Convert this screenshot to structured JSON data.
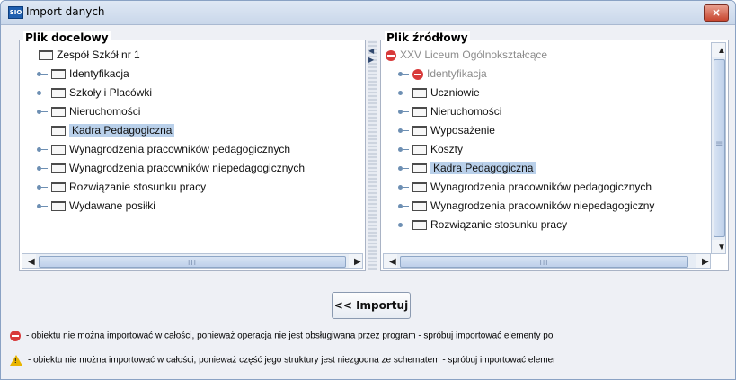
{
  "window": {
    "app_icon_text": "SIO",
    "title": "Import danych",
    "close_label": "×"
  },
  "left_panel": {
    "legend": "Plik docelowy",
    "items": [
      {
        "label": "Zespół Szkół nr 1",
        "icon": "folder-icon",
        "level": 0
      },
      {
        "label": "Identyfikacja",
        "icon": "folder-icon",
        "level": 1
      },
      {
        "label": "Szkoły i Placówki",
        "icon": "folder-icon",
        "level": 1
      },
      {
        "label": "Nieruchomości",
        "icon": "folder-icon",
        "level": 1
      },
      {
        "label": "Kadra Pedagogiczna",
        "icon": "folder-icon",
        "level": 1,
        "selected": true
      },
      {
        "label": "Wynagrodzenia pracowników pedagogicznych",
        "icon": "folder-icon",
        "level": 1
      },
      {
        "label": "Wynagrodzenia pracowników niepedagogicznych",
        "icon": "folder-icon",
        "level": 1
      },
      {
        "label": "Rozwiązanie stosunku pracy",
        "icon": "folder-icon",
        "level": 1
      },
      {
        "label": "Wydawane posiłki",
        "icon": "folder-icon",
        "level": 1
      }
    ],
    "hscroll": {
      "left_arrow": "◀",
      "right_arrow": "▶",
      "grip": "III"
    }
  },
  "right_panel": {
    "legend": "Plik źródłowy",
    "items": [
      {
        "label": "XXV Liceum Ogólnokształcące",
        "icon": "ban-icon",
        "level": 0,
        "disabled": true
      },
      {
        "label": "Identyfikacja",
        "icon": "ban-icon",
        "level": 1,
        "disabled": true
      },
      {
        "label": "Uczniowie",
        "icon": "folder-icon",
        "level": 1
      },
      {
        "label": "Nieruchomości",
        "icon": "folder-icon",
        "level": 1
      },
      {
        "label": "Wyposażenie",
        "icon": "folder-icon",
        "level": 1
      },
      {
        "label": "Koszty",
        "icon": "folder-icon",
        "level": 1
      },
      {
        "label": "Kadra Pedagogiczna",
        "icon": "folder-icon",
        "level": 1,
        "selected": true
      },
      {
        "label": "Wynagrodzenia pracowników pedagogicznych",
        "icon": "folder-icon",
        "level": 1
      },
      {
        "label": "Wynagrodzenia pracowników niepedagogiczny",
        "icon": "folder-icon",
        "level": 1
      },
      {
        "label": "Rozwiązanie stosunku pracy",
        "icon": "folder-icon",
        "level": 1
      }
    ],
    "hscroll": {
      "left_arrow": "◀",
      "right_arrow": "▶",
      "grip": "III"
    },
    "vscroll": {
      "up_arrow": "▲",
      "down_arrow": "▼",
      "grip": "≡"
    }
  },
  "divider": {
    "left_arrow": "◀",
    "right_arrow": "▶"
  },
  "import_button": {
    "label": "<< Importuj"
  },
  "notes": [
    {
      "icon": "ban-icon",
      "text": "- obiektu nie można importować w całości, ponieważ operacja nie jest obsługiwana przez program - spróbuj importować elementy po"
    },
    {
      "icon": "warning-icon",
      "text": "- obiektu nie można importować w całości, ponieważ część jego struktury jest niezgodna ze schematem - spróbuj importować elemer"
    }
  ],
  "colors": {
    "selection": "#b9d0ea",
    "ban": "#d83a3a",
    "warning": "#e9b500",
    "close": "#c8462f"
  }
}
